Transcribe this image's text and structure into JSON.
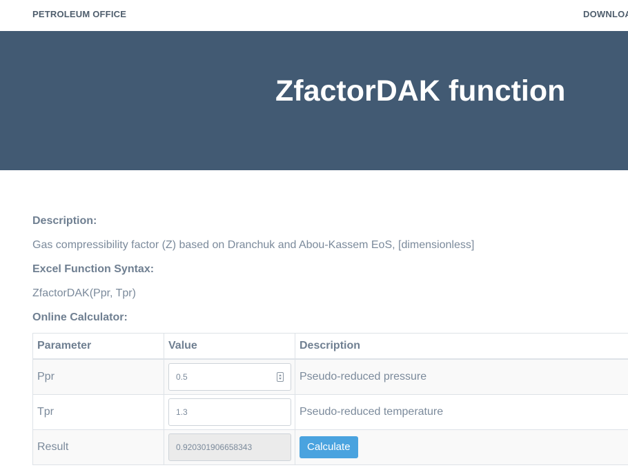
{
  "nav": {
    "brand": "PETROLEUM OFFICE",
    "download_link": "DOWNLOA"
  },
  "hero": {
    "title": "ZfactorDAK function"
  },
  "content": {
    "description_label": "Description:",
    "description_text": "Gas compressibility factor (Z) based on Dranchuk and Abou-Kassem EoS, [dimensionless]",
    "syntax_label": "Excel Function Syntax:",
    "syntax_text": "ZfactorDAK(Ppr, Tpr)",
    "calculator_label": "Online Calculator:"
  },
  "calculator": {
    "headers": [
      "Parameter",
      "Value",
      "Description"
    ],
    "rows": [
      {
        "parameter": "Ppr",
        "value": "0.5",
        "description": "Pseudo-reduced pressure"
      },
      {
        "parameter": "Tpr",
        "value": "1.3",
        "description": "Pseudo-reduced temperature"
      }
    ],
    "result": {
      "parameter": "Result",
      "value": "0.920301906658343",
      "button": "Calculate"
    }
  },
  "colors": {
    "hero_bg": "#425a73",
    "button_bg": "#4aa3df",
    "brand_text": "#4e5d6c"
  },
  "icons": {
    "ppr_input_spinner": "spinner-icon"
  }
}
